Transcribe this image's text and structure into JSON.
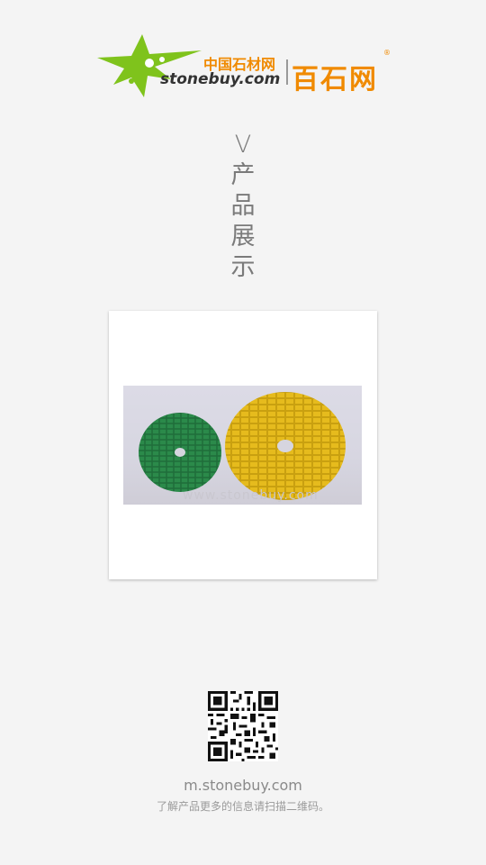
{
  "header": {
    "logo_cn_small": "中国石材网",
    "logo_domain": "stonebuy.com",
    "logo_cn_big": "百石网",
    "logo_registered": "®"
  },
  "title": {
    "chars": [
      "V",
      "产",
      "品",
      "展",
      "示"
    ]
  },
  "product": {
    "watermark": "www.stonebuy.com"
  },
  "footer": {
    "site": "m.stonebuy.com",
    "hint": "了解产品更多的信息请扫描二维码。"
  },
  "colors": {
    "brand_orange": "#f08a00",
    "logo_green": "#7fc31c",
    "pad_green": "#1f6e3a",
    "pad_yellow": "#e0b317"
  },
  "icons": [
    "stonebuy-logo-icon",
    "qr-code-icon"
  ]
}
